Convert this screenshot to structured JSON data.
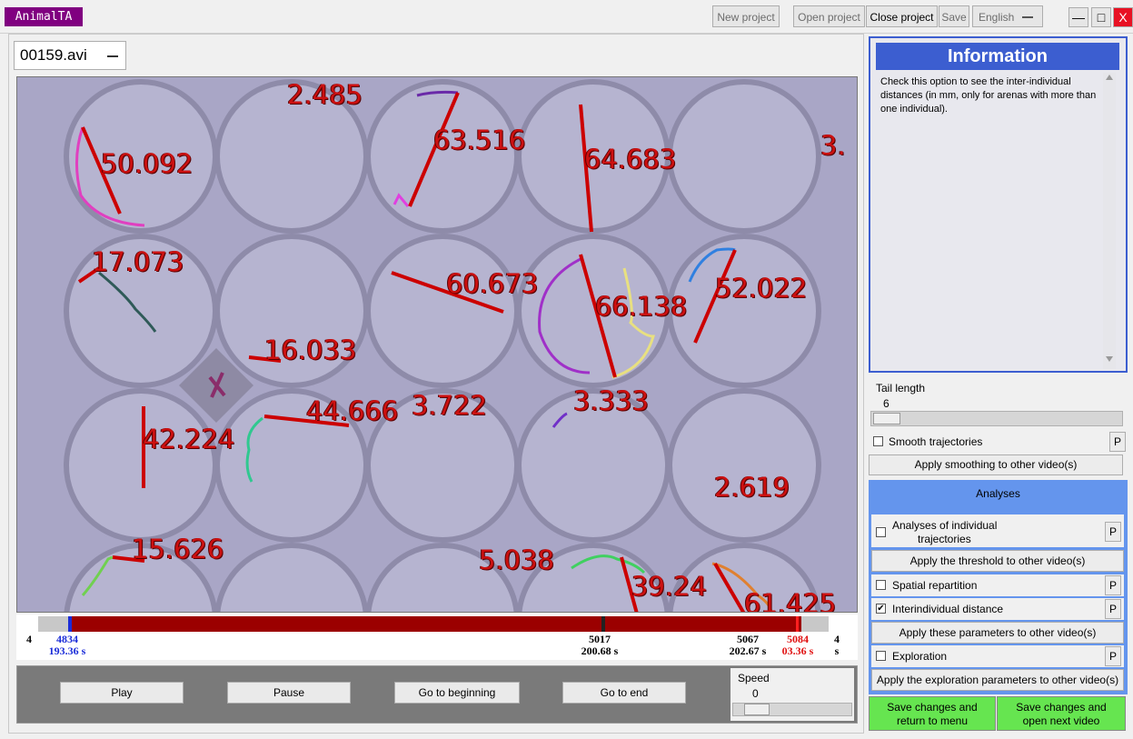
{
  "app": {
    "name": "AnimalTA"
  },
  "toolbar": {
    "new_project": "New project",
    "open_project": "Open project",
    "close_project": "Close project",
    "save": "Save",
    "language": "English"
  },
  "window_controls": {
    "minimize": "—",
    "maximize": "□",
    "close": "X"
  },
  "video": {
    "file": "00159.avi",
    "distance_labels": [
      "2.485",
      "50.092",
      "63.516",
      "64.683",
      "3.",
      "17.073",
      "60.673",
      "66.138",
      "52.022",
      "16.033",
      "44.666",
      "3.722",
      "3.333",
      "42.224",
      "2.619",
      "15.626",
      "5.038",
      "39.24",
      "61.425"
    ]
  },
  "timeline": {
    "start_frame": "4",
    "start_time": "s",
    "cursor_frame": "4834",
    "cursor_time": "193.36 s",
    "mid_frame": "5017",
    "mid_time": "200.68 s",
    "right_frame": "5067",
    "right_time": "202.67 s",
    "end_marker_frame": "5084",
    "end_marker_time": "03.36 s",
    "end_frame": "4",
    "end_time": "s"
  },
  "controls": {
    "play": "Play",
    "pause": "Pause",
    "go_beginning": "Go to beginning",
    "go_end": "Go to end",
    "speed_label": "Speed",
    "speed_value": "0"
  },
  "info": {
    "title": "Information",
    "text": "Check this option to see the inter-individual distances (in mm, only for arenas with more than one individual)."
  },
  "tail": {
    "label": "Tail length",
    "value": "6"
  },
  "options": {
    "smooth": "Smooth trajectories",
    "apply_smoothing": "Apply smoothing to other video(s)",
    "analyses_title": "Analyses",
    "individual_line1": "Analyses of individual",
    "individual_line2": "trajectories",
    "apply_threshold": "Apply the threshold to other video(s)",
    "spatial": "Spatial repartition",
    "interindividual": "Interindividual distance",
    "apply_params": "Apply these parameters to other video(s)",
    "exploration": "Exploration",
    "apply_exploration": "Apply the exploration parameters to other video(s)",
    "p": "P",
    "check": "✔"
  },
  "footer": {
    "save_return_1": "Save changes and",
    "save_return_2": "return to menu",
    "save_next_1": "Save changes and",
    "save_next_2": "open next video"
  }
}
